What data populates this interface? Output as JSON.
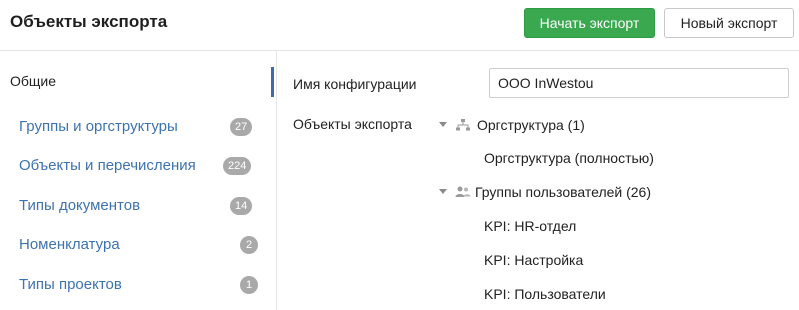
{
  "header": {
    "title": "Объекты экспорта",
    "start_button": "Начать экспорт",
    "new_button": "Новый экспорт",
    "accent_color": "#3aa84f"
  },
  "sidebar": {
    "general_label": "Общие",
    "items": [
      {
        "label": "Группы и оргструктуры",
        "count": "27"
      },
      {
        "label": "Объекты и перечисления",
        "count": "224"
      },
      {
        "label": "Типы документов",
        "count": "14"
      },
      {
        "label": "Номенклатура",
        "count": "2"
      },
      {
        "label": "Типы проектов",
        "count": "1"
      }
    ]
  },
  "main": {
    "config_label": "Имя конфигурации",
    "config_value": "ООО InWestou",
    "objects_label": "Объекты экспорта",
    "tree": {
      "orgstructure": {
        "label": "Оргструктура (1)",
        "icon": "org-structure-icon",
        "children": [
          "Оргструктура (полностью)"
        ]
      },
      "user_groups": {
        "label": "Группы пользователей (26)",
        "icon": "user-group-icon",
        "children": [
          "KPI: HR-отдел",
          "KPI: Настройка",
          "KPI: Пользователи"
        ]
      }
    }
  }
}
